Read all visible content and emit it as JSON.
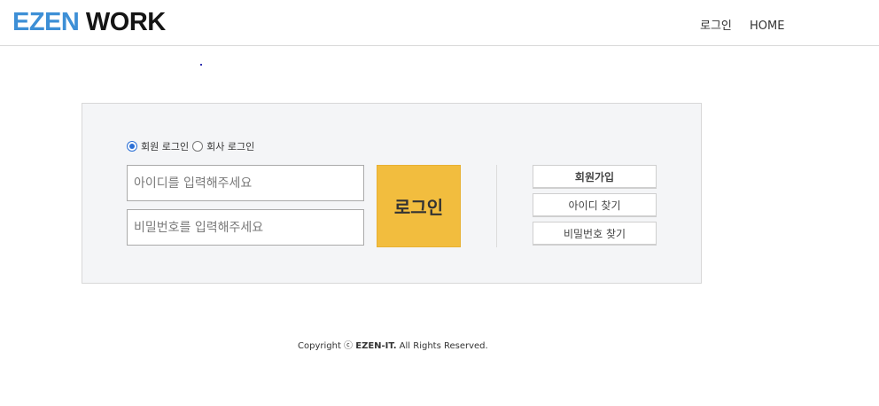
{
  "header": {
    "logo_part1": "EZEN",
    "logo_part2": "WORK",
    "nav": {
      "login": "로그인",
      "home": "HOME"
    }
  },
  "login_panel": {
    "radio_member_label": "회원 로그인",
    "radio_company_label": "회사 로그인",
    "selected_radio": "회원 로그인",
    "id_placeholder": "아이디를 입력해주세요",
    "pw_placeholder": "비밀번호를 입력해주세요",
    "login_button": "로그인",
    "join_button": "회원가입",
    "find_id_button": "아이디 찾기",
    "find_pw_button": "비밀번호 찾기"
  },
  "footer": {
    "prefix": "Copyright ⓒ ",
    "brand": "EZEN-IT.",
    "suffix": " All Rights Reserved."
  },
  "colors": {
    "logo_blue": "#3d8fd6",
    "login_button": "#f2bd3e",
    "panel_bg": "#f4f5f7"
  }
}
